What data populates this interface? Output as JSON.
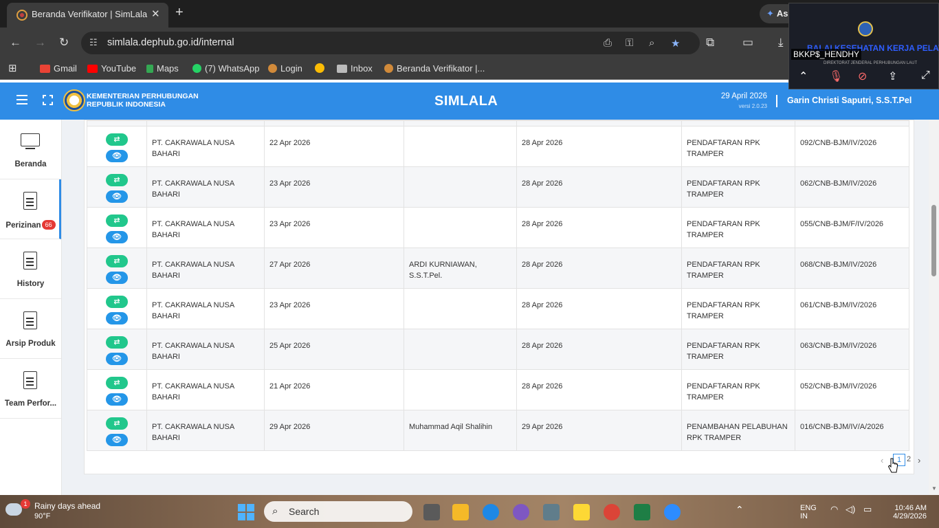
{
  "browser": {
    "tab_title": "Beranda Verifikator | SimLala",
    "tab_close": "✕",
    "new_tab": "+",
    "assist_label": "As",
    "url": "simlala.dephub.go.id/internal",
    "bookmarks": [
      {
        "label": "",
        "icon": "apps-grid-icon"
      },
      {
        "label": "Gmail",
        "icon": "gmail-icon",
        "color": "#ea4335"
      },
      {
        "label": "YouTube",
        "icon": "youtube-icon",
        "color": "#ff0000"
      },
      {
        "label": "Maps",
        "icon": "maps-icon",
        "color": "#34a853"
      },
      {
        "label": "(7) WhatsApp",
        "icon": "whatsapp-icon",
        "color": "#25d366"
      },
      {
        "label": "Login",
        "icon": "site-icon",
        "color": "#d18a3a"
      },
      {
        "label": "",
        "icon": "photos-icon",
        "color": "#fbbc05"
      },
      {
        "label": "Inbox",
        "icon": "mail-icon",
        "color": "#bbbbbb"
      },
      {
        "label": "Beranda Verifikator |...",
        "icon": "site-icon",
        "color": "#d18a3a"
      }
    ]
  },
  "header": {
    "ministry_line1": "KEMENTERIAN PERHUBUNGAN",
    "ministry_line2": "REPUBLIK INDONESIA",
    "title": "SIMLALA",
    "date": "29 April 2026",
    "version": "versi 2.0.23",
    "user": "Garin Christi Saputri, S.S.T.Pel",
    "accent_color": "#2f8ce6"
  },
  "sidebar": {
    "items": [
      {
        "label": "Beranda",
        "icon": "monitor-icon"
      },
      {
        "label": "Perizinan",
        "icon": "document-icon",
        "badge": "66",
        "active": true
      },
      {
        "label": "History",
        "icon": "document-icon"
      },
      {
        "label": "Arsip Produk",
        "icon": "document-icon"
      },
      {
        "label": "Team Perfor...",
        "icon": "document-icon"
      }
    ]
  },
  "table": {
    "action_icons": {
      "process": "⇄",
      "view": "👁"
    },
    "rows": [
      {
        "company": "PT. CAKRAWALA NUSA BAHARI",
        "submitted": "22 Apr 2026",
        "verifier": "",
        "date": "28 Apr 2026",
        "type": "PENDAFTARAN RPK TRAMPER",
        "number": "092/CNB-BJM/IV/2026"
      },
      {
        "company": "PT. CAKRAWALA NUSA BAHARI",
        "submitted": "23 Apr 2026",
        "verifier": "",
        "date": "28 Apr 2026",
        "type": "PENDAFTARAN RPK TRAMPER",
        "number": "062/CNB-BJM/IV/2026"
      },
      {
        "company": "PT. CAKRAWALA NUSA BAHARI",
        "submitted": "23 Apr 2026",
        "verifier": "",
        "date": "28 Apr 2026",
        "type": "PENDAFTARAN RPK TRAMPER",
        "number": "055/CNB-BJM/F/IV/2026"
      },
      {
        "company": "PT. CAKRAWALA NUSA BAHARI",
        "submitted": "27 Apr 2026",
        "verifier": "ARDI KURNIAWAN, S.S.T.Pel.",
        "date": "28 Apr 2026",
        "type": "PENDAFTARAN RPK TRAMPER",
        "number": "068/CNB-BJM/IV/2026"
      },
      {
        "company": "PT. CAKRAWALA NUSA BAHARI",
        "submitted": "23 Apr 2026",
        "verifier": "",
        "date": "28 Apr 2026",
        "type": "PENDAFTARAN RPK TRAMPER",
        "number": "061/CNB-BJM/IV/2026"
      },
      {
        "company": "PT. CAKRAWALA NUSA BAHARI",
        "submitted": "25 Apr 2026",
        "verifier": "",
        "date": "28 Apr 2026",
        "type": "PENDAFTARAN RPK TRAMPER",
        "number": "063/CNB-BJM/IV/2026"
      },
      {
        "company": "PT. CAKRAWALA NUSA BAHARI",
        "submitted": "21 Apr 2026",
        "verifier": "",
        "date": "28 Apr 2026",
        "type": "PENDAFTARAN RPK TRAMPER",
        "number": "052/CNB-BJM/IV/2026"
      },
      {
        "company": "PT. CAKRAWALA NUSA BAHARI",
        "submitted": "29 Apr 2026",
        "verifier": "Muhammad Aqil Shalihin",
        "date": "29 Apr 2026",
        "type": "PENAMBAHAN PELABUHAN RPK TRAMPER",
        "number": "016/CNB-BJM/IV/A/2026"
      }
    ]
  },
  "pagination": {
    "prev": "‹",
    "current": "1",
    "next_page": "2",
    "next": "›"
  },
  "overlay": {
    "participant": "BKKP$_HENDHY",
    "banner": "BALAI KESEHATAN KERJA PELAYARAN",
    "sub": "DIREKTORAT JENDERAL PERHUBUNGAN LAUT"
  },
  "taskbar": {
    "weather_badge": "1",
    "weather_title": "Rainy days ahead",
    "weather_temp": "90°F",
    "search_label": "Search",
    "lang1": "ENG",
    "lang2": "IN",
    "time": "10:46 AM",
    "date": "4/29/2026"
  }
}
